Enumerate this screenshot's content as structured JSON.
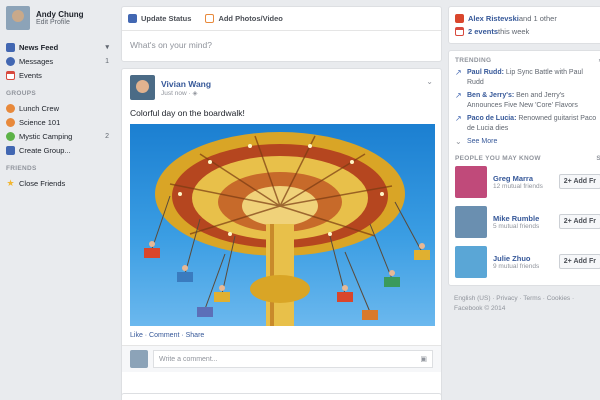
{
  "profile": {
    "name": "Andy Chung",
    "edit": "Edit Profile"
  },
  "nav": [
    {
      "label": "News Feed",
      "count": "",
      "color": "#4267b2"
    },
    {
      "label": "Messages",
      "count": "1",
      "color": "#4267b2"
    },
    {
      "label": "Events",
      "count": "",
      "color": "#d8493d"
    }
  ],
  "groups_header": "GROUPS",
  "groups": [
    {
      "label": "Lunch Crew",
      "count": "",
      "color": "#e8893b"
    },
    {
      "label": "Science 101",
      "count": "",
      "color": "#e8893b"
    },
    {
      "label": "Mystic Camping",
      "count": "2",
      "color": "#5cb247"
    },
    {
      "label": "Create Group...",
      "count": "",
      "color": "#4267b2"
    }
  ],
  "friends_header": "FRIENDS",
  "friends": [
    {
      "label": "Close Friends",
      "count": "",
      "color": "#f2b631"
    }
  ],
  "composer": {
    "tab1": "Update Status",
    "tab2": "Add Photos/Video",
    "placeholder": "What's on your mind?"
  },
  "post": {
    "author": "Vivian Wang",
    "time": "Just now · ",
    "text": "Colorful day on the boardwalk!",
    "actions": "Like · Comment · Share",
    "comment_placeholder": "Write a comment..."
  },
  "birthday": {
    "name": "Alex Ristevski",
    "rest": " and 1 other"
  },
  "events": {
    "count": "2 events",
    "rest": " this week"
  },
  "trending": {
    "header": "TRENDING",
    "items": [
      {
        "name": "Paul Rudd:",
        "desc": " Lip Sync Battle with Paul Rudd"
      },
      {
        "name": "Ben & Jerry's:",
        "desc": " Ben and Jerry's Announces Five New 'Core' Flavors"
      },
      {
        "name": "Paco de Lucia:",
        "desc": " Renowned guitarist Paco de Lucia dies"
      }
    ],
    "see_more": "See More"
  },
  "pymk": {
    "header": "PEOPLE YOU MAY KNOW",
    "people": [
      {
        "name": "Greg Marra",
        "mutual": "12 mutual friends",
        "color": "#c04a7a"
      },
      {
        "name": "Mike Rumble",
        "mutual": "5 mutual friends",
        "color": "#6a8fb0"
      },
      {
        "name": "Julie Zhuo",
        "mutual": "9 mutual friends",
        "color": "#5aa6d6"
      }
    ],
    "add_label": "Add Fr"
  },
  "footer": {
    "line1": "English (US) · Privacy · Terms · Cookies ·",
    "line2": "Facebook © 2014"
  }
}
